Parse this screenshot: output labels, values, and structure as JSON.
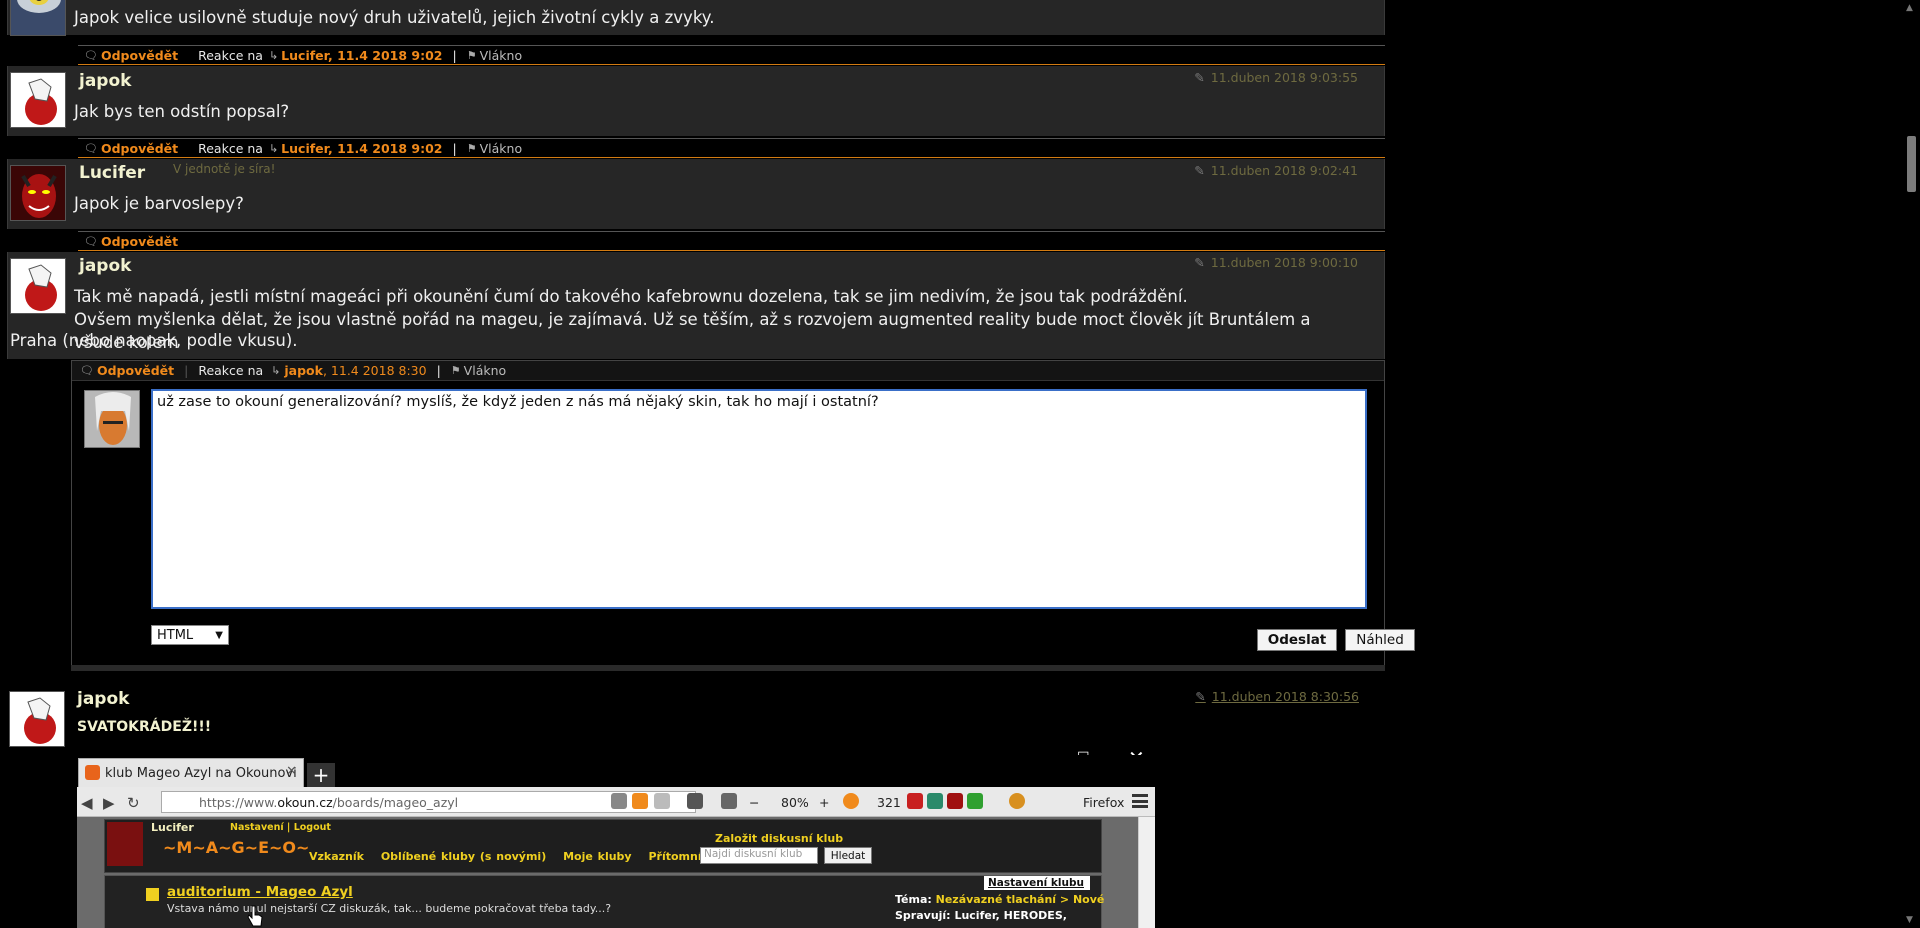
{
  "posts": [
    {
      "author": "",
      "motto": "",
      "date": "",
      "body": "Japok velice usilovně studuje nový druh uživatelů, jejich životní cykly a zvyky."
    },
    {
      "author": "japok",
      "motto": "",
      "date": "11.duben 2018 9:03:55",
      "body": "Jak bys ten odstín popsal?"
    },
    {
      "author": "Lucifer",
      "motto": "V jednotě je síra!",
      "date": "11.duben 2018 9:02:41",
      "body": "Japok je barvoslepy?"
    },
    {
      "author": "japok",
      "motto": "",
      "date": "11.duben 2018 9:00:10",
      "body_lines": [
        "Tak mě napadá, jestli místní mageáci při okounění čumí do takového kafebrownu dozelena, tak se jim nedivím, že jsou tak podráždění.",
        "Ovšem myšlenka dělat, že jsou vlastně pořád na mageu, je zajímavá. Už se těším, až s rozvojem augmented reality bude moct člověk jít Bruntálem a všude kolem",
        "Praha (nebo naopak, podle vkusu)."
      ]
    },
    {
      "author": "japok",
      "motto": "",
      "date": "11.duben 2018 8:30:56",
      "body": "SVATOKRÁDEŽ!!!"
    }
  ],
  "bars": [
    {
      "reply": "Odpovědět",
      "reaction_label": "Reakce na",
      "reaction_target": "Lucifer, 11.4 2018 9:02",
      "thread": "Vlákno"
    },
    {
      "reply": "Odpovědět",
      "reaction_label": "Reakce na",
      "reaction_target": "Lucifer, 11.4 2018 9:02",
      "thread": "Vlákno"
    },
    {
      "reply": "Odpovědět"
    },
    {
      "reply": "Odpovědět",
      "reaction_label": "Reakce na",
      "reaction_target_name": "japok",
      "reaction_target_date": ", 11.4 2018 8:30",
      "thread": "Vlákno"
    }
  ],
  "reply_form": {
    "text": "už zase to okouní generalizování? myslíš, že když jeden z nás má nějaký skin, tak ho mají i ostatní?",
    "format": "HTML",
    "submit": "Odeslat",
    "preview": "Náhled"
  },
  "embedded_screenshot": {
    "tab_title": "klub Mageo Azyl na Okounovi",
    "url_prefix": "https://www.",
    "url_domain": "okoun.cz",
    "url_path": "/boards/mageo_azyl",
    "zoom": "80%",
    "count": "321",
    "browser": "Firefox",
    "user": "Lucifer",
    "user_links": "Nastavení   |   Logout",
    "logo": "~M~A~G~E~O~",
    "menu": [
      "Vzkazník",
      "Oblíbené kluby (s novými)",
      "Moje kluby",
      "Přítomní"
    ],
    "found_club": "Založit diskusní klub",
    "search_placeholder": "Najdi diskusní klub",
    "search_button": "Hledat",
    "club_title": "auditorium - Mageo Azyl",
    "club_desc": "Vstava námo unul nejstarší CZ diskuzák, tak... budeme pokračovat třeba tady...?",
    "settings_link": "Nastavení klubu",
    "topic_label": "Téma:",
    "topic_value": "Nezávazné tlachání > Nové",
    "admins_label": "Spravují:",
    "admins_value": "Lucifer, HERODES,"
  }
}
